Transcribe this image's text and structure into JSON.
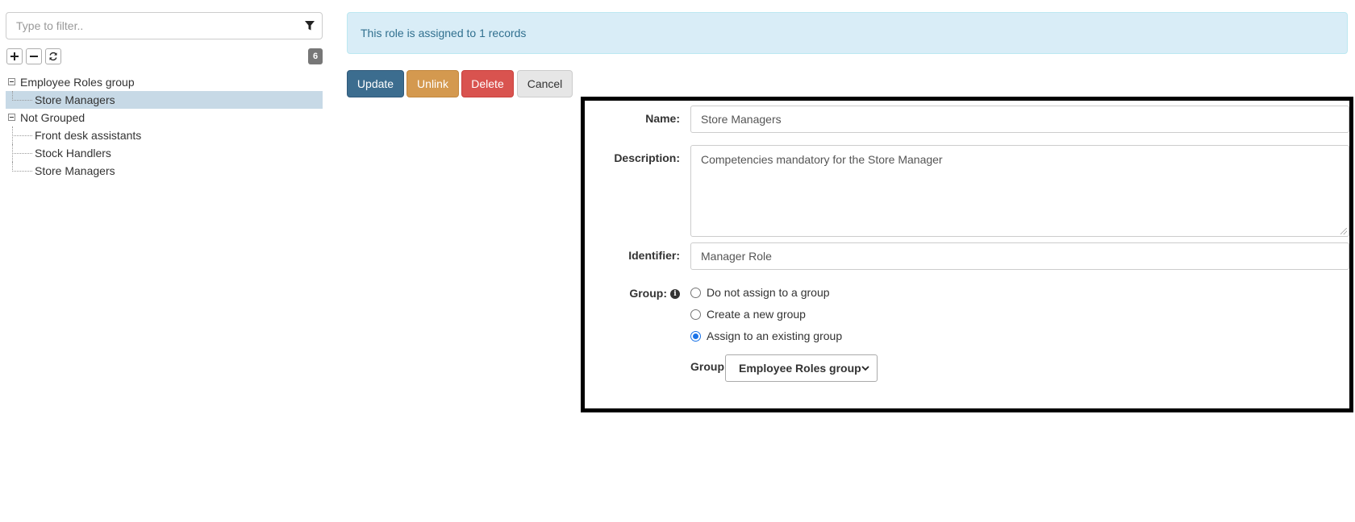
{
  "sidebar": {
    "filter_placeholder": "Type to filter..",
    "count": "6",
    "tree": {
      "groups": [
        {
          "label": "Employee Roles group",
          "children": [
            "Store Managers"
          ]
        },
        {
          "label": "Not Grouped",
          "children": [
            "Front desk assistants",
            "Stock Handlers",
            "Store Managers"
          ]
        }
      ],
      "selected": "Store Managers"
    },
    "icons": {
      "filter": "filter-icon",
      "expand_all": "plus-icon",
      "collapse_all": "minus-icon",
      "refresh": "refresh-icon"
    }
  },
  "alert": {
    "text": "This role is assigned to 1 records"
  },
  "actions": {
    "update": "Update",
    "unlink": "Unlink",
    "delete": "Delete",
    "cancel": "Cancel"
  },
  "form": {
    "name_label": "Name:",
    "name_value": "Store Managers",
    "description_label": "Description:",
    "description_value": "Competencies mandatory for the Store Manager",
    "identifier_label": "Identifier:",
    "identifier_value": "Manager Role",
    "group_label": "Group:",
    "group_options": {
      "none": "Do not assign to a group",
      "new": "Create a new group",
      "existing": "Assign to an existing group"
    },
    "group_selected_option": "existing",
    "group_select_label": "Group:",
    "group_select_value": "Employee Roles group"
  },
  "colors": {
    "alert_bg": "#d9edf7",
    "alert_text": "#31708f",
    "update": "#3c6d8f",
    "unlink": "#d4994f",
    "delete": "#d9534f",
    "cancel": "#e6e6e6",
    "selected_row": "#c7d9e6"
  }
}
